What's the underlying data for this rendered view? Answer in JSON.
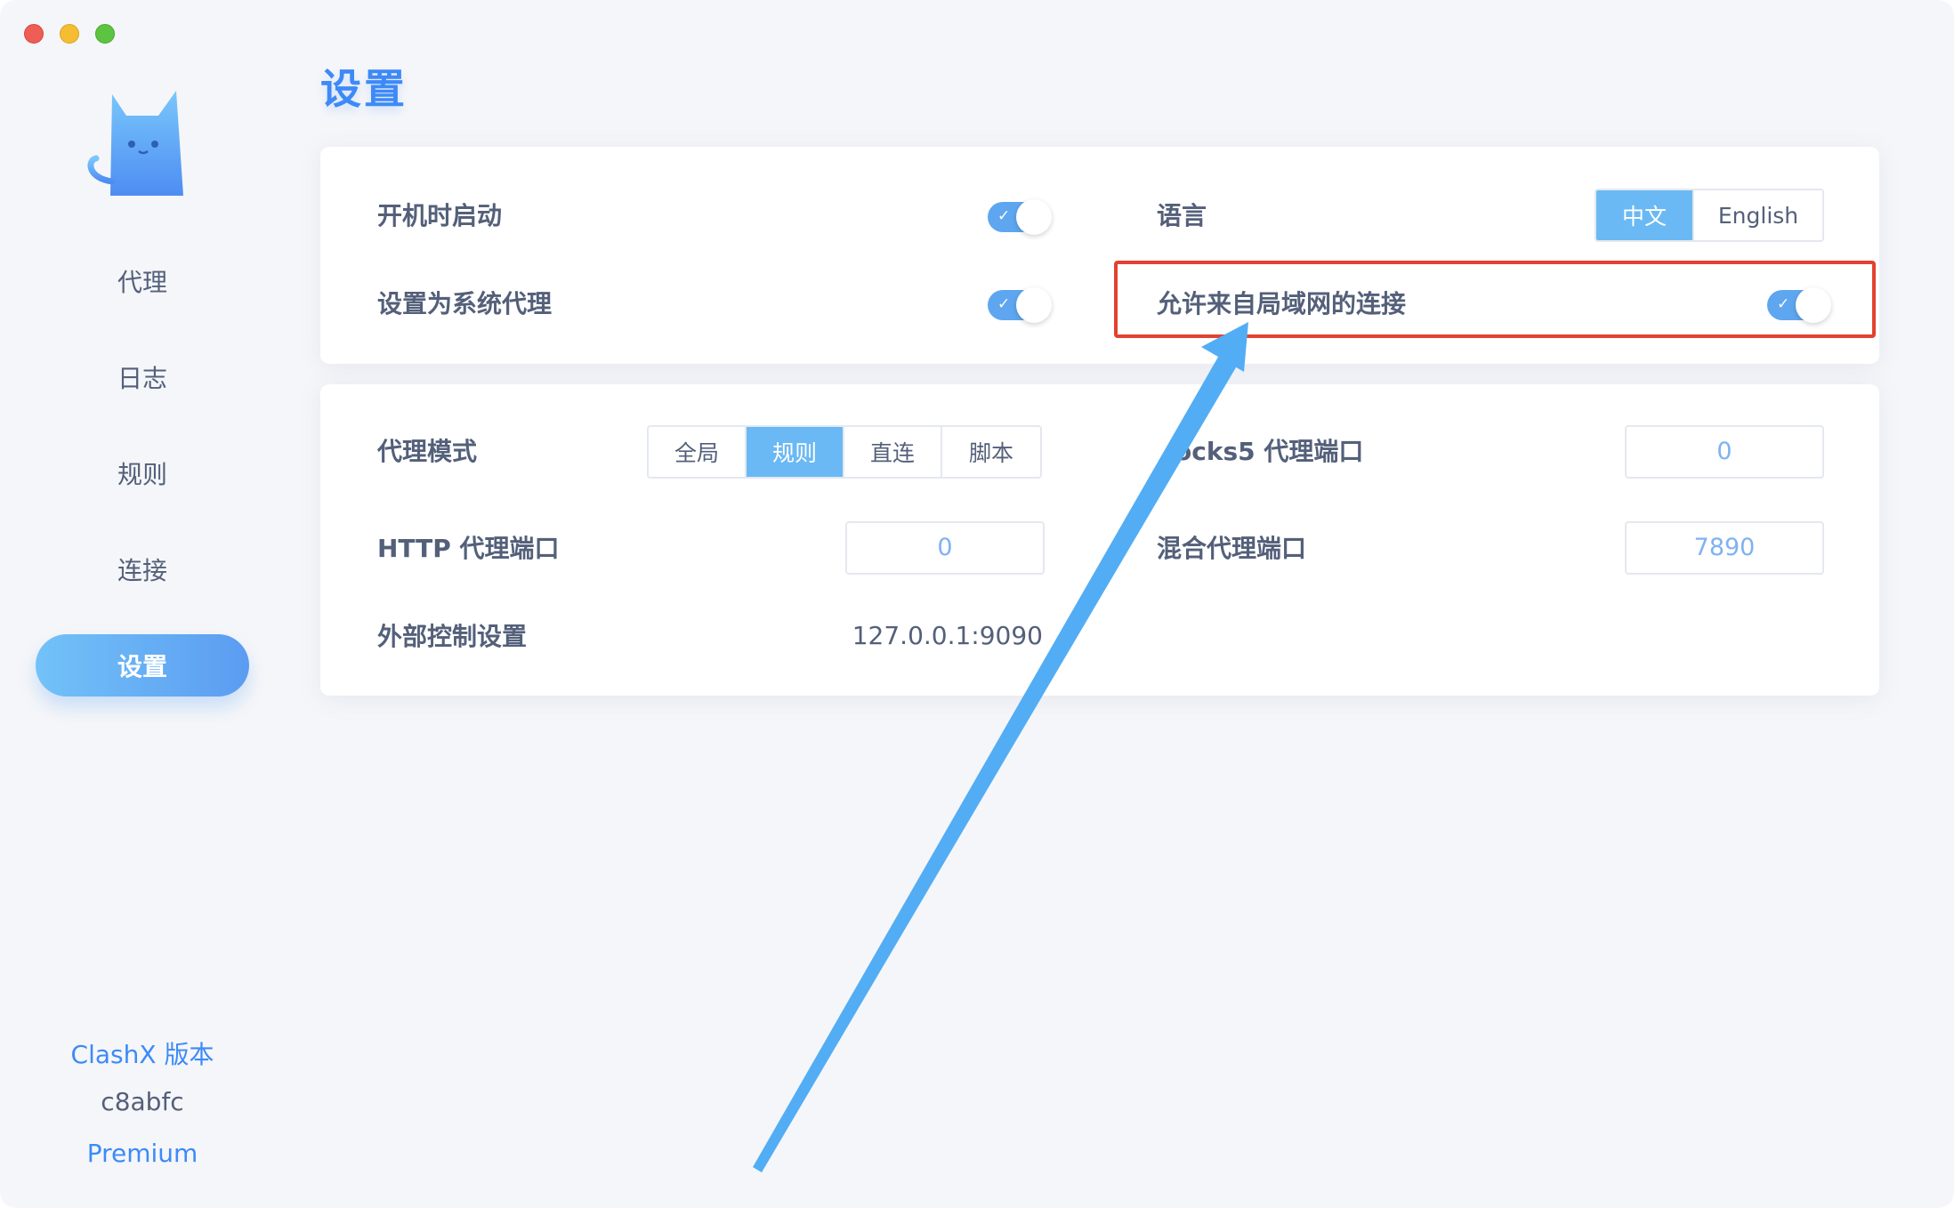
{
  "window": {
    "title": "设置"
  },
  "sidebar": {
    "items": [
      {
        "label": "代理",
        "active": false
      },
      {
        "label": "日志",
        "active": false
      },
      {
        "label": "规则",
        "active": false
      },
      {
        "label": "连接",
        "active": false
      },
      {
        "label": "设置",
        "active": true
      }
    ],
    "footer": {
      "version_title": "ClashX 版本",
      "version_hash": "c8abfc",
      "edition": "Premium"
    }
  },
  "general": {
    "launch_at_login": {
      "label": "开机时启动",
      "enabled": true
    },
    "set_system_proxy": {
      "label": "设置为系统代理",
      "enabled": true
    },
    "language": {
      "label": "语言",
      "options": [
        "中文",
        "English"
      ],
      "selected": "中文"
    },
    "allow_lan": {
      "label": "允许来自局域网的连接",
      "enabled": true
    }
  },
  "proxy": {
    "mode": {
      "label": "代理模式",
      "options": [
        "全局",
        "规则",
        "直连",
        "脚本"
      ],
      "selected": "规则"
    },
    "http_port": {
      "label": "HTTP 代理端口",
      "value": "0"
    },
    "socks5_port": {
      "label": "ocks5 代理端口",
      "value": "0"
    },
    "mixed_port": {
      "label": "混合代理端口",
      "value": "7890"
    },
    "external_controller": {
      "label": "外部控制设置",
      "value": "127.0.0.1:9090"
    }
  },
  "colors": {
    "accent": "#3d8af7",
    "toggle_on": "#5ea6f0",
    "segment_active": "#6ab9f4",
    "annotation_box": "#e2422f",
    "annotation_arrow": "#52adf5"
  }
}
